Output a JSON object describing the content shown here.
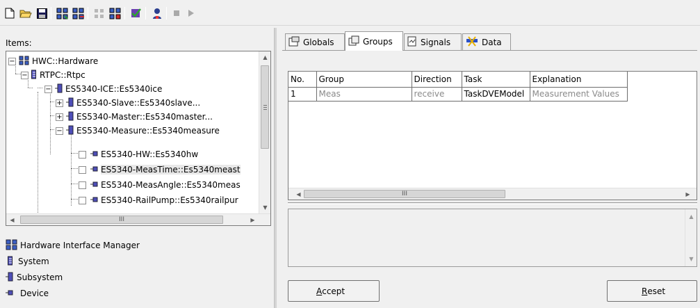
{
  "toolbar": {
    "buttons": [
      {
        "icon": "new-file-icon"
      },
      {
        "icon": "open-folder-icon"
      },
      {
        "icon": "save-icon"
      },
      {
        "icon": "hardware-add-icon"
      },
      {
        "icon": "hardware-remove-icon"
      },
      {
        "icon": "module-disabled-icon"
      },
      {
        "icon": "module-add-icon"
      },
      {
        "icon": "check-icon"
      },
      {
        "icon": "user-icon"
      },
      {
        "icon": "stop-icon"
      },
      {
        "icon": "play-icon"
      }
    ]
  },
  "left": {
    "items_label": "Items:",
    "tree": [
      {
        "label": "HWC::Hardware",
        "level": 0,
        "expander": "−"
      },
      {
        "label": "RTPC::Rtpc",
        "level": 1,
        "expander": "−"
      },
      {
        "label": "ES5340-ICE::Es5340ice",
        "level": 2,
        "expander": "−"
      },
      {
        "label": "ES5340-Slave::Es5340slave...",
        "level": 3,
        "expander": "+"
      },
      {
        "label": "ES5340-Master::Es5340master...",
        "level": 3,
        "expander": "+"
      },
      {
        "label": "ES5340-Measure::Es5340measure",
        "level": 3,
        "expander": "−"
      },
      {
        "label": "ES5340-HW::Es5340hw",
        "level": 4
      },
      {
        "label": "ES5340-MeasTime::Es5340meast",
        "level": 4
      },
      {
        "label": "ES5340-MeasAngle::Es5340meas",
        "level": 4
      },
      {
        "label": "ES5340-RailPump::Es5340railpur",
        "level": 4
      }
    ],
    "hscroll_grip": "III",
    "legend": [
      {
        "label": "Hardware Interface Manager",
        "icon": "hardware-interface-manager-icon"
      },
      {
        "label": "System",
        "icon": "system-icon"
      },
      {
        "label": "Subsystem",
        "icon": "subsystem-icon"
      },
      {
        "label": "Device",
        "icon": "device-icon"
      }
    ]
  },
  "tabs": [
    {
      "label": "Globals",
      "icon": "globals-icon",
      "active": false
    },
    {
      "label": "Groups",
      "icon": "groups-icon",
      "active": true
    },
    {
      "label": "Signals",
      "icon": "signals-icon",
      "active": false
    },
    {
      "label": "Data",
      "icon": "data-icon",
      "active": false
    }
  ],
  "table": {
    "columns": [
      "No.",
      "Group",
      "Direction",
      "Task",
      "Explanation"
    ],
    "rows": [
      [
        "1",
        "Meas",
        "receive",
        "TaskDVEModel",
        "Measurement Values"
      ]
    ],
    "hscroll_grip": "III"
  },
  "buttons": {
    "accept": {
      "mnemonic": "A",
      "rest": "ccept"
    },
    "reset": {
      "mnemonic": "R",
      "rest": "eset"
    }
  }
}
